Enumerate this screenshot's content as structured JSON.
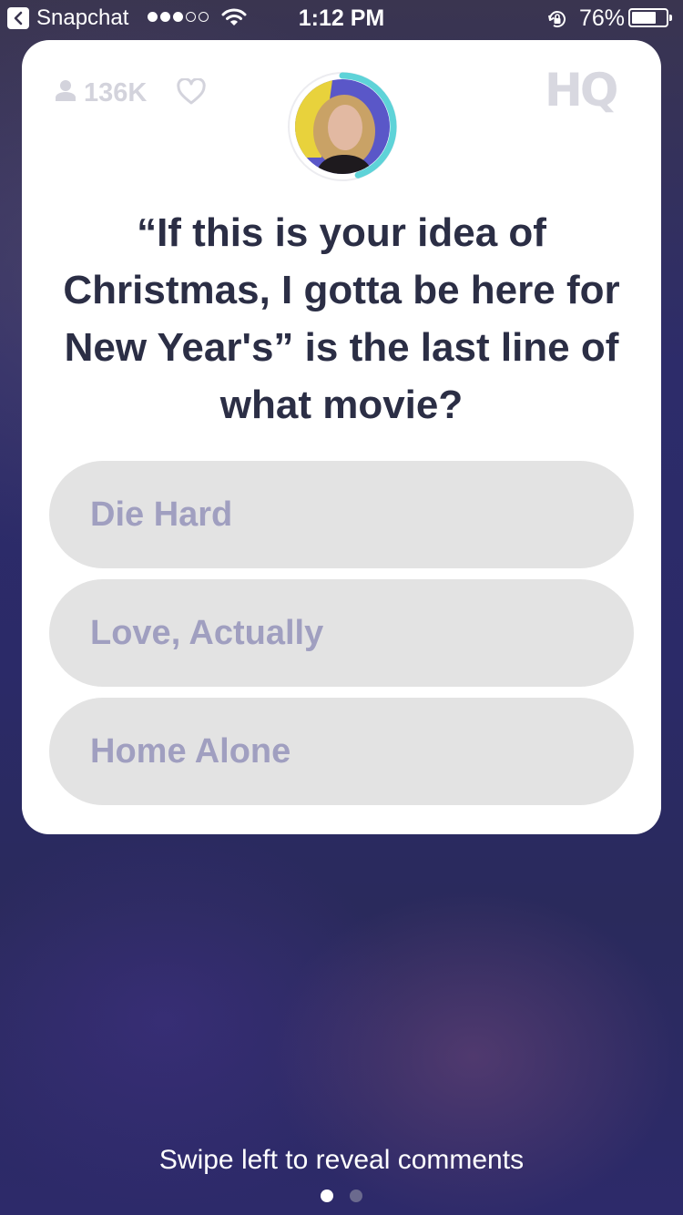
{
  "status_bar": {
    "back_app_label": "Snapchat",
    "signal_bars_filled": 3,
    "signal_bars_total": 5,
    "time": "1:12 PM",
    "battery_percent_label": "76%",
    "battery_level": 0.76
  },
  "card": {
    "viewer_count": "136K",
    "logo_text": "HQ",
    "host_timer_fraction": 0.45,
    "question": "“If this is your idea of Christmas, I gotta be here for New Year's” is the last line of what movie?",
    "answers": [
      {
        "label": "Die Hard"
      },
      {
        "label": "Love, Actually"
      },
      {
        "label": "Home Alone"
      }
    ]
  },
  "footer": {
    "swipe_hint": "Swipe left to reveal comments",
    "page_count": 2,
    "active_page": 1
  },
  "colors": {
    "card_bg": "#ffffff",
    "question_text": "#2b2e45",
    "answer_bg": "#e3e3e3",
    "answer_text": "#a09fc0",
    "timer_ring": "#5ed3d8",
    "muted_icon": "#d3d3dc"
  },
  "icons": {
    "back": "chevron-left-icon",
    "wifi": "wifi-icon",
    "rotation_lock": "rotation-lock-icon",
    "battery": "battery-icon",
    "viewers": "person-icon",
    "like": "heart-icon"
  }
}
